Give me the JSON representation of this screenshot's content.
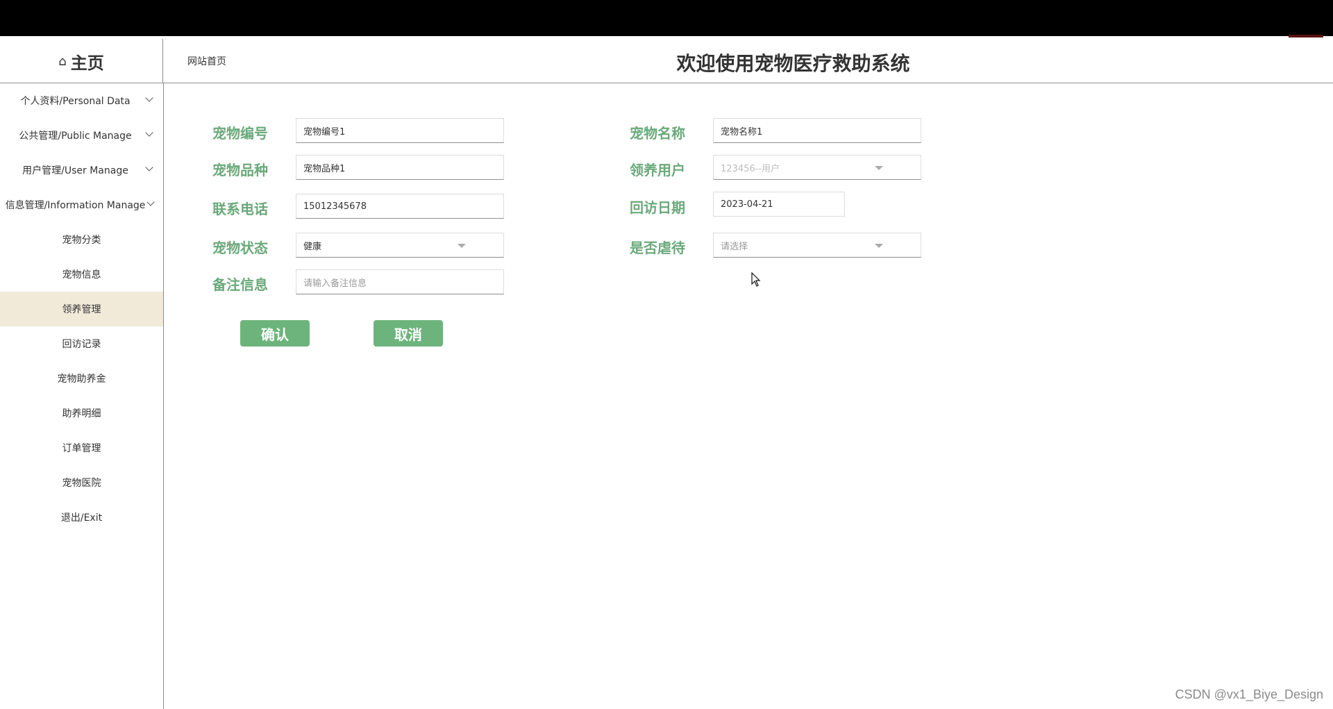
{
  "colors": {
    "accent": "#6db47c",
    "label_green": "#6aa97a",
    "active_menu_bg": "#f1ead9"
  },
  "header": {
    "home_icon": "home-icon",
    "home_label": "主页",
    "site_link": "网站首页",
    "title": "欢迎使用宠物医疗救助系统"
  },
  "sidebar": {
    "items": [
      {
        "label": "个人资料/Personal Data",
        "expandable": true
      },
      {
        "label": "公共管理/Public Manage",
        "expandable": true
      },
      {
        "label": "用户管理/User Manage",
        "expandable": true
      },
      {
        "label": "信息管理/Information Manage",
        "expandable": true
      },
      {
        "label": "宠物分类"
      },
      {
        "label": "宠物信息"
      },
      {
        "label": "领养管理",
        "active": true
      },
      {
        "label": "回访记录"
      },
      {
        "label": "宠物助养金"
      },
      {
        "label": "助养明细"
      },
      {
        "label": "订单管理"
      },
      {
        "label": "宠物医院"
      },
      {
        "label": "退出/Exit"
      }
    ]
  },
  "form": {
    "pet_no": {
      "label": "宠物编号",
      "value": "宠物编号1"
    },
    "pet_name": {
      "label": "宠物名称",
      "value": "宠物名称1"
    },
    "pet_breed": {
      "label": "宠物品种",
      "value": "宠物品种1"
    },
    "adopter": {
      "label": "领养用户",
      "value": "123456--用户"
    },
    "phone": {
      "label": "联系电话",
      "value": "15012345678"
    },
    "visit_date": {
      "label": "回访日期",
      "value": "2023-04-21"
    },
    "pet_status": {
      "label": "宠物状态",
      "value": "健康"
    },
    "abused": {
      "label": "是否虐待",
      "placeholder": "请选择"
    },
    "remark": {
      "label": "备注信息",
      "placeholder": "请输入备注信息"
    },
    "confirm_label": "确认",
    "cancel_label": "取消"
  },
  "watermark": "CSDN @vx1_Biye_Design"
}
